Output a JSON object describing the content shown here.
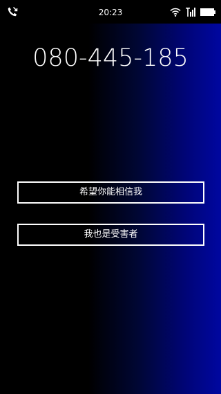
{
  "status_bar": {
    "time": "20:23",
    "icons": [
      "call-forward-icon",
      "wifi-icon",
      "signal-icon",
      "battery-icon"
    ]
  },
  "call": {
    "phone_number": "080-445-185"
  },
  "options": [
    {
      "label": "希望你能相信我"
    },
    {
      "label": "我也是受害者"
    }
  ],
  "colors": {
    "background_left": "#000000",
    "background_right": "#0007a0",
    "text": "#ffffff",
    "button_border": "#ffffff"
  }
}
